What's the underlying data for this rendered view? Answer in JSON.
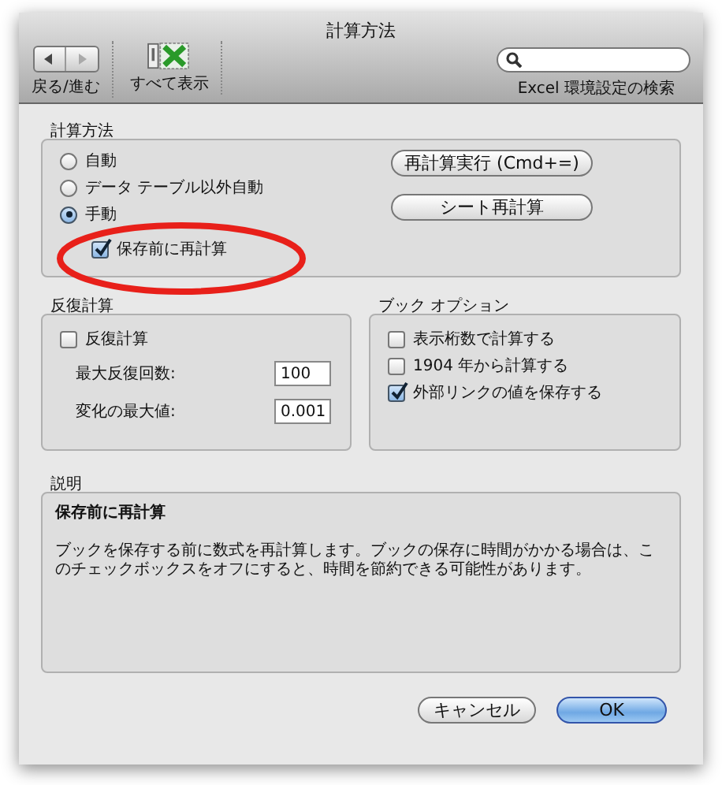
{
  "window": {
    "title": "計算方法"
  },
  "toolbar": {
    "nav_label": "戻る/進む",
    "show_all_label": "すべて表示",
    "search_caption": "Excel 環境設定の検索"
  },
  "calculation": {
    "title": "計算方法",
    "options": [
      {
        "label": "自動",
        "selected": false
      },
      {
        "label": "データ テーブル以外自動",
        "selected": false
      },
      {
        "label": "手動",
        "selected": true
      }
    ],
    "save_before": {
      "label": "保存前に再計算",
      "checked": true
    },
    "buttons": [
      "再計算実行 (Cmd+=)",
      "シート再計算"
    ]
  },
  "iteration": {
    "title": "反復計算",
    "enabled": {
      "label": "反復計算",
      "checked": false
    },
    "fields": [
      {
        "label": "最大反復回数:",
        "value": "100"
      },
      {
        "label": "変化の最大値:",
        "value": "0.001"
      }
    ]
  },
  "book_options": {
    "title": "ブック オプション",
    "options": [
      {
        "label": "表示桁数で計算する",
        "checked": false
      },
      {
        "label": "1904 年から計算する",
        "checked": false
      },
      {
        "label": "外部リンクの値を保存する",
        "checked": true
      }
    ]
  },
  "description": {
    "title": "説明",
    "heading": "保存前に再計算",
    "text": "ブックを保存する前に数式を再計算します。ブックの保存に時間がかかる場合は、このチェックボックスをオフにすると、時間を節約できる可能性があります。"
  },
  "buttons": [
    {
      "label": "キャンセル",
      "default": false
    },
    {
      "label": "OK",
      "default": true
    }
  ]
}
